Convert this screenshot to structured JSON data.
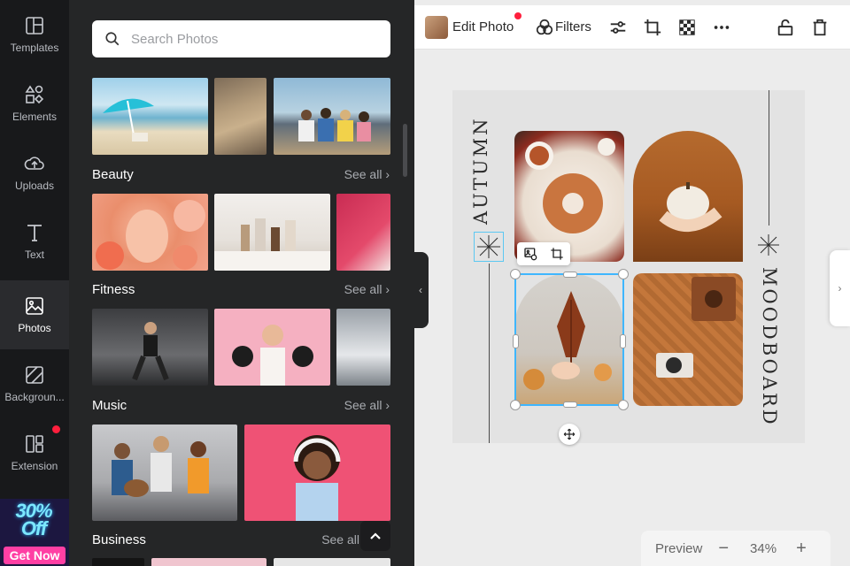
{
  "rail": {
    "items": [
      {
        "label": "Templates",
        "icon": "templates-icon"
      },
      {
        "label": "Elements",
        "icon": "elements-icon"
      },
      {
        "label": "Uploads",
        "icon": "uploads-icon"
      },
      {
        "label": "Text",
        "icon": "text-icon"
      },
      {
        "label": "Photos",
        "icon": "photos-icon",
        "active": true
      },
      {
        "label": "Backgroun...",
        "icon": "background-icon"
      },
      {
        "label": "Extension",
        "icon": "extension-icon",
        "badge": true
      }
    ],
    "promo": {
      "headline": "30% Off",
      "cta": "Get Now"
    }
  },
  "panel": {
    "search_placeholder": "Search Photos",
    "sections": [
      {
        "title": "Beauty",
        "see_all": "See all"
      },
      {
        "title": "Fitness",
        "see_all": "See all"
      },
      {
        "title": "Music",
        "see_all": "See all"
      },
      {
        "title": "Business",
        "see_all": "See all"
      }
    ]
  },
  "toolbar": {
    "edit_photo": "Edit Photo",
    "filters": "Filters"
  },
  "canvas": {
    "left_text": "AUTUMN",
    "right_text": "MOODBOARD"
  },
  "zoom": {
    "preview": "Preview",
    "minus": "−",
    "value": "34%",
    "plus": "+"
  },
  "colors": {
    "accent": "#3fb6ff",
    "badge": "#ff1f3d",
    "promo_cta": "#ff3fa4",
    "rail_bg": "#18191b",
    "panel_bg": "#252627"
  }
}
